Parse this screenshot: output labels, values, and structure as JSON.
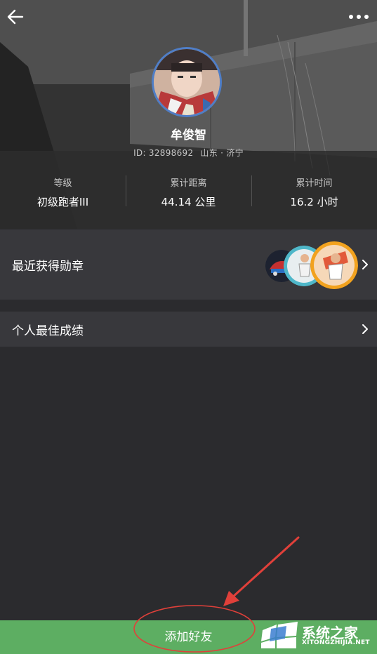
{
  "profile": {
    "name": "牟俊智",
    "id_text": "ID: 32898692",
    "location": "山东 · 济宁"
  },
  "stats": [
    {
      "label": "等级",
      "value": "初级跑者III"
    },
    {
      "label": "累计距离",
      "value": "44.14 公里"
    },
    {
      "label": "累计时间",
      "value": "16.2 小时"
    }
  ],
  "rows": {
    "recent_badges": "最近获得勋章",
    "personal_best": "个人最佳成绩"
  },
  "footer": {
    "add_friend": "添加好友"
  },
  "watermark": {
    "title": "系统之家",
    "url": "XITONGZHIJIA.NET"
  },
  "icons": {
    "back": "arrow-left-icon",
    "more": "more-dots-icon",
    "chevron": "chevron-right-icon"
  },
  "colors": {
    "footer_green": "#5dae62",
    "annotation_red": "#e0403a",
    "avatar_ring": "#4f7ec7",
    "panel": "#38383c",
    "background": "#2b2b2e"
  }
}
